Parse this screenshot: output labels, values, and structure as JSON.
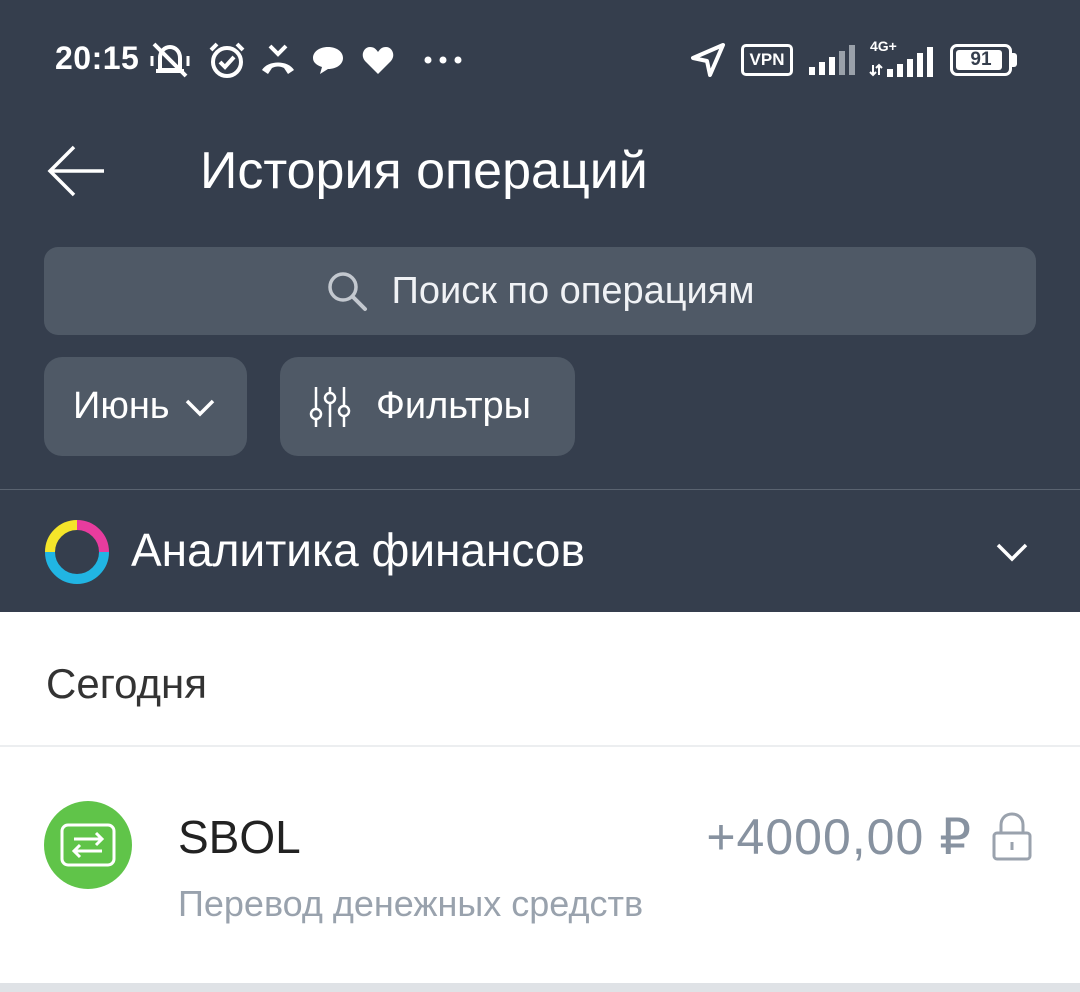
{
  "status_bar": {
    "time": "20:15",
    "vpn": "VPN",
    "network": "4G+",
    "battery": "91",
    "battery_level": 0.91,
    "icons": [
      "mute-icon",
      "alarm-icon",
      "missed-call-icon",
      "message-icon",
      "heart-icon",
      "more-dots-icon",
      "location-arrow-icon",
      "signal-icon"
    ]
  },
  "header": {
    "title": "История операций"
  },
  "search": {
    "placeholder": "Поиск по операциям"
  },
  "chips": {
    "month": "Июнь",
    "filters": "Фильтры"
  },
  "analytics": {
    "label": "Аналитика финансов"
  },
  "section": {
    "date": "Сегодня"
  },
  "operations": [
    {
      "title": "SBOL",
      "subtitle": "Перевод денежных средств",
      "amount": "+4000,00 ₽"
    }
  ],
  "colors": {
    "header_bg": "#353e4d",
    "control_bg": "#4f5966",
    "accent_green": "#60c449",
    "amount_gray": "#8792a0"
  }
}
